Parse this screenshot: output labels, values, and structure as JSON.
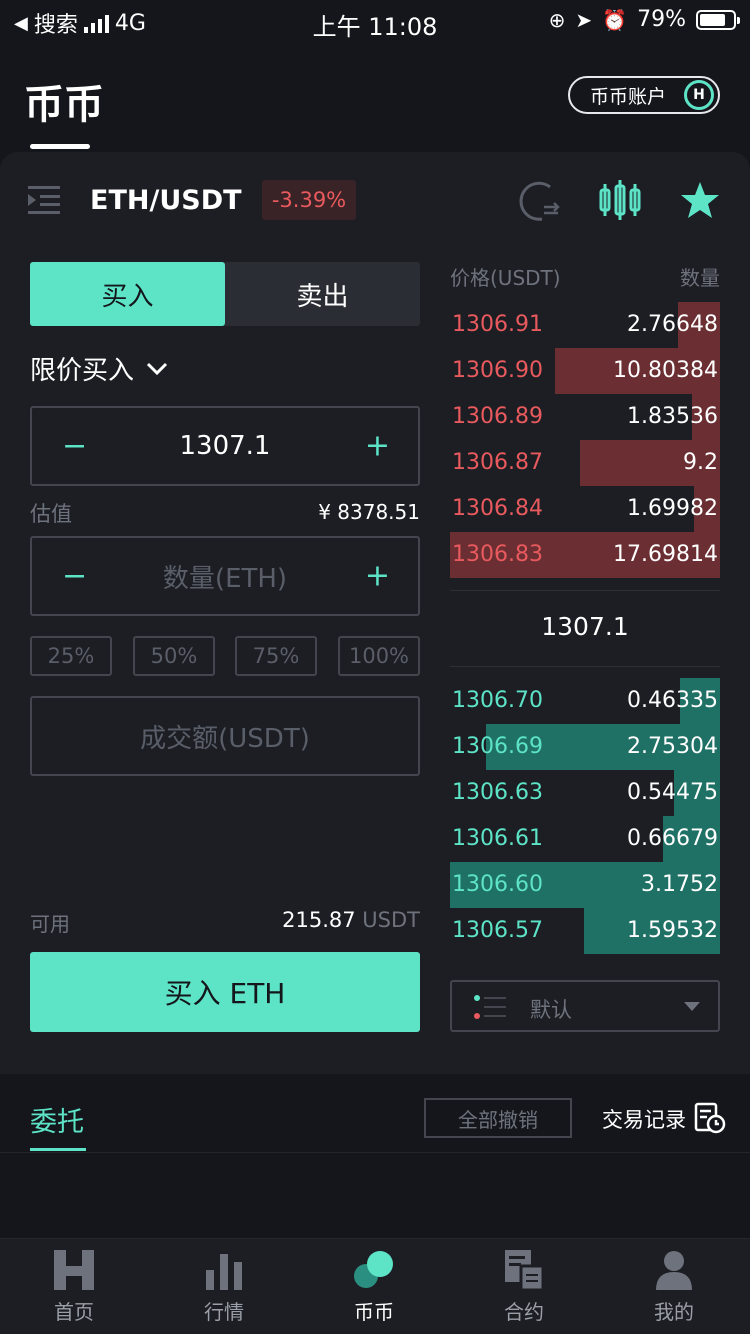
{
  "status_bar": {
    "back_app": "搜索",
    "network": "4G",
    "time": "上午 11:08",
    "battery": "79%"
  },
  "header": {
    "title": "币币",
    "account_button": "币币账户",
    "account_logo": "H"
  },
  "pair": {
    "name": "ETH/USDT",
    "change": "-3.39%"
  },
  "trade": {
    "buy_tab": "买入",
    "sell_tab": "卖出",
    "order_type": "限价买入",
    "price_value": "1307.1",
    "minus": "−",
    "plus": "+",
    "estimate_label": "估值",
    "estimate_value": "¥ 8378.51",
    "amount_placeholder": "数量(ETH)",
    "percents": [
      "25%",
      "50%",
      "75%",
      "100%"
    ],
    "total_placeholder": "成交额(USDT)",
    "available_label": "可用",
    "available_value": "215.87",
    "available_unit": "USDT",
    "buy_button": "买入 ETH"
  },
  "orderbook": {
    "price_header": "价格(USDT)",
    "qty_header": "数量",
    "asks": [
      {
        "price": "1306.91",
        "qty": "2.76648"
      },
      {
        "price": "1306.90",
        "qty": "10.80384"
      },
      {
        "price": "1306.89",
        "qty": "1.83536"
      },
      {
        "price": "1306.87",
        "qty": "9.2"
      },
      {
        "price": "1306.84",
        "qty": "1.69982"
      },
      {
        "price": "1306.83",
        "qty": "17.69814"
      }
    ],
    "last_price": "1307.1",
    "bids": [
      {
        "price": "1306.70",
        "qty": "0.46335"
      },
      {
        "price": "1306.69",
        "qty": "2.75304"
      },
      {
        "price": "1306.63",
        "qty": "0.54475"
      },
      {
        "price": "1306.61",
        "qty": "0.66679"
      },
      {
        "price": "1306.60",
        "qty": "3.1752"
      },
      {
        "price": "1306.57",
        "qty": "1.59532"
      }
    ],
    "depth_mode": "默认"
  },
  "orders": {
    "tab": "委托",
    "cancel_all": "全部撤销",
    "history": "交易记录"
  },
  "nav": [
    {
      "label": "首页",
      "icon": "home-icon"
    },
    {
      "label": "行情",
      "icon": "market-icon"
    },
    {
      "label": "币币",
      "icon": "spot-icon"
    },
    {
      "label": "合约",
      "icon": "contract-icon"
    },
    {
      "label": "我的",
      "icon": "profile-icon"
    }
  ],
  "colors": {
    "accent": "#5de4c7",
    "down": "#e85a5d",
    "background": "#1c1e24"
  }
}
